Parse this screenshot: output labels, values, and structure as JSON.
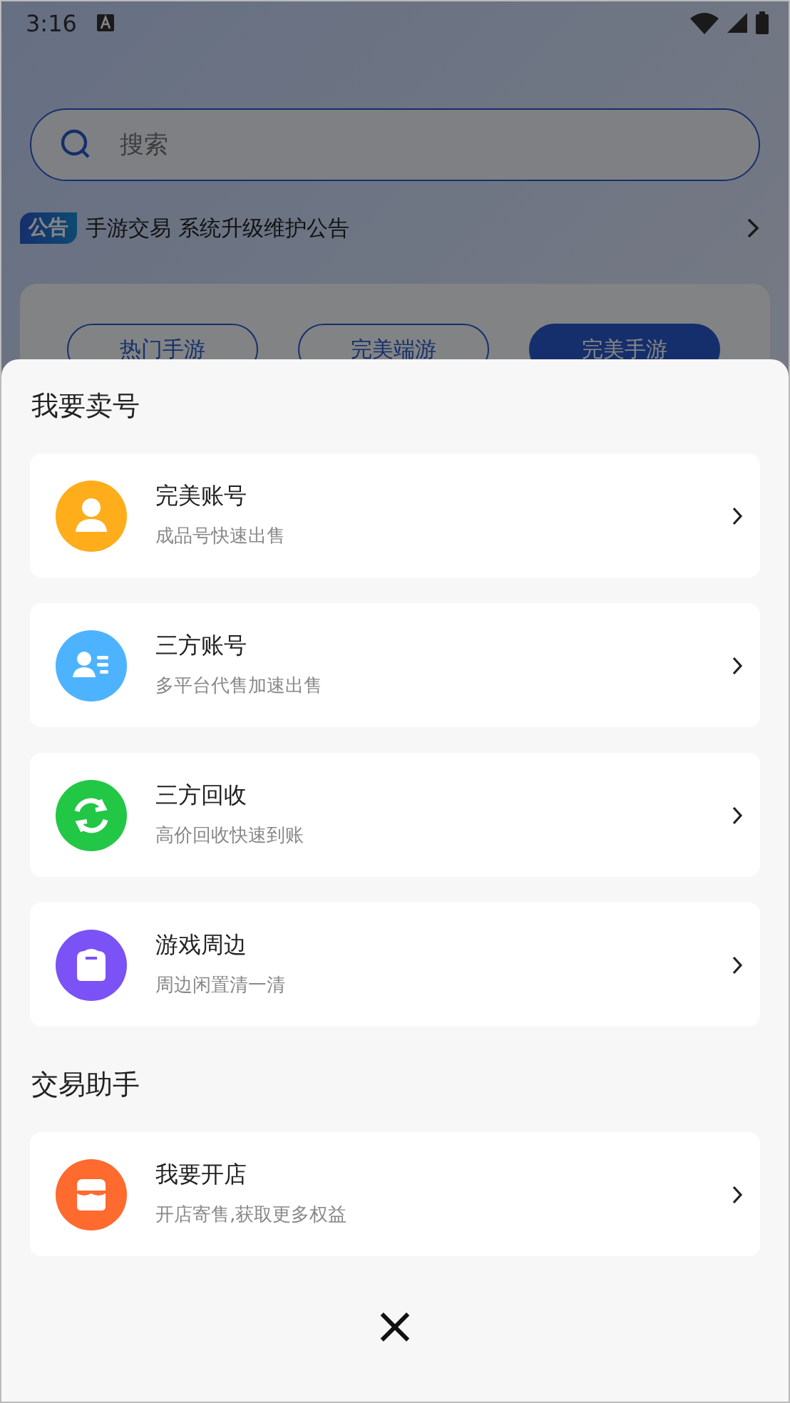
{
  "status_bar": {
    "time": "3:16"
  },
  "search": {
    "placeholder": "搜索"
  },
  "notice": {
    "badge": "公告",
    "text": "手游交易 系统升级维护公告"
  },
  "tabs": [
    {
      "label": "热门手游",
      "selected": false
    },
    {
      "label": "完美端游",
      "selected": false
    },
    {
      "label": "完美手游",
      "selected": true
    }
  ],
  "sheet": {
    "sections": [
      {
        "title": "我要卖号",
        "items": [
          {
            "kind": "user",
            "color": "#ffad1a",
            "title": "完美账号",
            "subtitle": "成品号快速出售"
          },
          {
            "kind": "contact",
            "color": "#4db3ff",
            "title": "三方账号",
            "subtitle": "多平台代售加速出售"
          },
          {
            "kind": "recycle",
            "color": "#22c745",
            "title": "三方回收",
            "subtitle": "高价回收快速到账"
          },
          {
            "kind": "bag",
            "color": "#7a52f5",
            "title": "游戏周边",
            "subtitle": "周边闲置清一清"
          }
        ]
      },
      {
        "title": "交易助手",
        "items": [
          {
            "kind": "shop",
            "color": "#ff6a2e",
            "title": "我要开店",
            "subtitle": "开店寄售,获取更多权益"
          }
        ]
      }
    ],
    "close": "×"
  }
}
